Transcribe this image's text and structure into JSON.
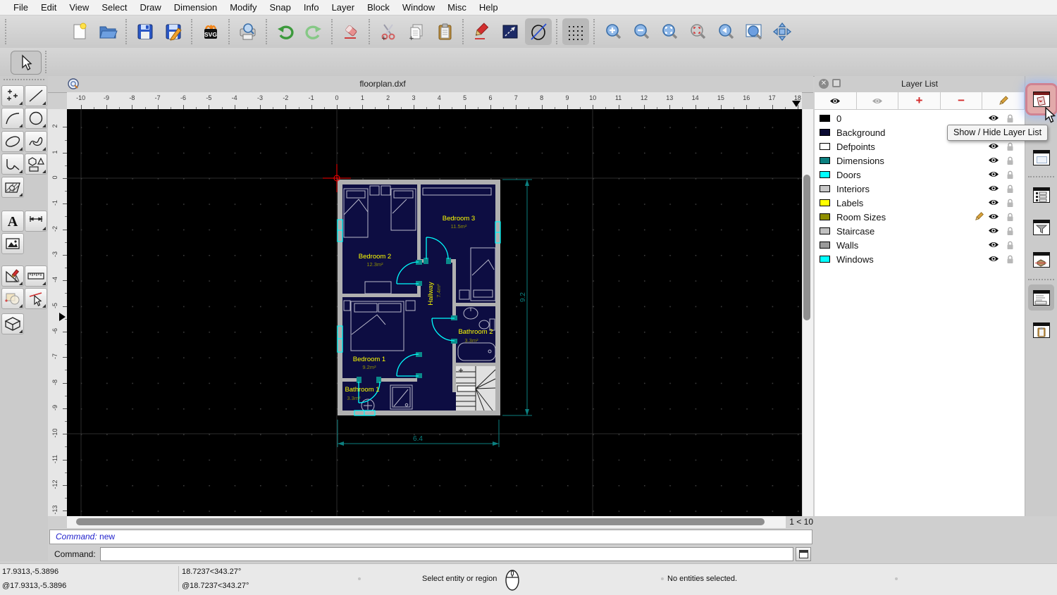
{
  "menu": {
    "items": [
      "File",
      "Edit",
      "View",
      "Select",
      "Draw",
      "Dimension",
      "Modify",
      "Snap",
      "Info",
      "Layer",
      "Block",
      "Window",
      "Misc",
      "Help"
    ]
  },
  "toolbar": {
    "icons": [
      "selection-arrow",
      "new-file",
      "open-file",
      "save",
      "save-as",
      "export-svg",
      "print-preview",
      "undo",
      "redo",
      "delete-eraser",
      "cut",
      "copy",
      "paste",
      "edit-pencil",
      "line-tool",
      "draft-mode",
      "grid-toggle",
      "zoom-in",
      "zoom-out",
      "auto-zoom",
      "zoom-selection",
      "previous-view",
      "zoom-window",
      "pan"
    ]
  },
  "tool_panel": {
    "tools": [
      "points",
      "lines",
      "arcs",
      "circles",
      "ellipses",
      "splines",
      "polylines",
      "shapes",
      "hatches",
      "text",
      "dimensions",
      "image",
      "draw-misc",
      "measure",
      "modify",
      "modify-select",
      "viewport-3d"
    ]
  },
  "document": {
    "title": "floorplan.dxf",
    "zoom_indicator": "1 < 10",
    "ruler_h_ticks": [
      -10,
      -9,
      -8,
      -7,
      -6,
      -5,
      -4,
      -3,
      -2,
      -1,
      0,
      1,
      2,
      3,
      4,
      5,
      6,
      7,
      8,
      9,
      10,
      11,
      12,
      13,
      14,
      15,
      16,
      17,
      18
    ],
    "ruler_v_ticks": [
      2,
      1,
      0,
      -1,
      -2,
      -3,
      -4,
      -5,
      -6,
      -7,
      -8,
      -9,
      -10,
      -11,
      -12,
      -13
    ]
  },
  "floorplan": {
    "rooms": [
      {
        "name": "Bedroom 2",
        "area": "12.3m²"
      },
      {
        "name": "Bedroom 3",
        "area": "11.5m²"
      },
      {
        "name": "Bedroom 1",
        "area": "9.2m²"
      },
      {
        "name": "Bathroom 1",
        "area": "3.3m²"
      },
      {
        "name": "Bathroom 2",
        "area": "3.3m²"
      },
      {
        "name": "Hallway",
        "area": "7.4m²"
      }
    ],
    "dim_width": "6.4",
    "dim_height": "9.2",
    "colors": {
      "walls": "#b0b0b0",
      "rooms": "#0d0d42",
      "doors": "#00ffff",
      "windows": "#00ffff",
      "dimensions": "#0c8080",
      "labels": "#ffff00",
      "room_sizes": "#8f8f00"
    }
  },
  "layer_list": {
    "title": "Layer List",
    "tooltip": "Show / Hide Layer List",
    "layers": [
      {
        "name": "0",
        "color": "#000000",
        "current": false
      },
      {
        "name": "Background",
        "color": "#0a0a32",
        "current": false
      },
      {
        "name": "Defpoints",
        "color": "#ffffff",
        "current": false
      },
      {
        "name": "Dimensions",
        "color": "#0c8080",
        "current": false
      },
      {
        "name": "Doors",
        "color": "#00ffff",
        "current": false
      },
      {
        "name": "Interiors",
        "color": "#c8c8c8",
        "current": false
      },
      {
        "name": "Labels",
        "color": "#ffff00",
        "current": false
      },
      {
        "name": "Room Sizes",
        "color": "#8f8f00",
        "current": true
      },
      {
        "name": "Staircase",
        "color": "#c0c0c0",
        "current": false
      },
      {
        "name": "Walls",
        "color": "#9a9a9a",
        "current": false
      },
      {
        "name": "Windows",
        "color": "#00ffff",
        "current": false
      }
    ]
  },
  "command": {
    "history_prompt": "Command:",
    "history_value": "new",
    "prompt": "Command:",
    "input_value": ""
  },
  "status_bar": {
    "abs_coord": "17.9313,-5.3896",
    "rel_coord": "@17.9313,-5.3896",
    "polar_coord": "18.7237<343.27°",
    "polar_rel_coord": "@18.7237<343.27°",
    "hint": "Select entity or region",
    "selection_status": "No entities selected."
  }
}
